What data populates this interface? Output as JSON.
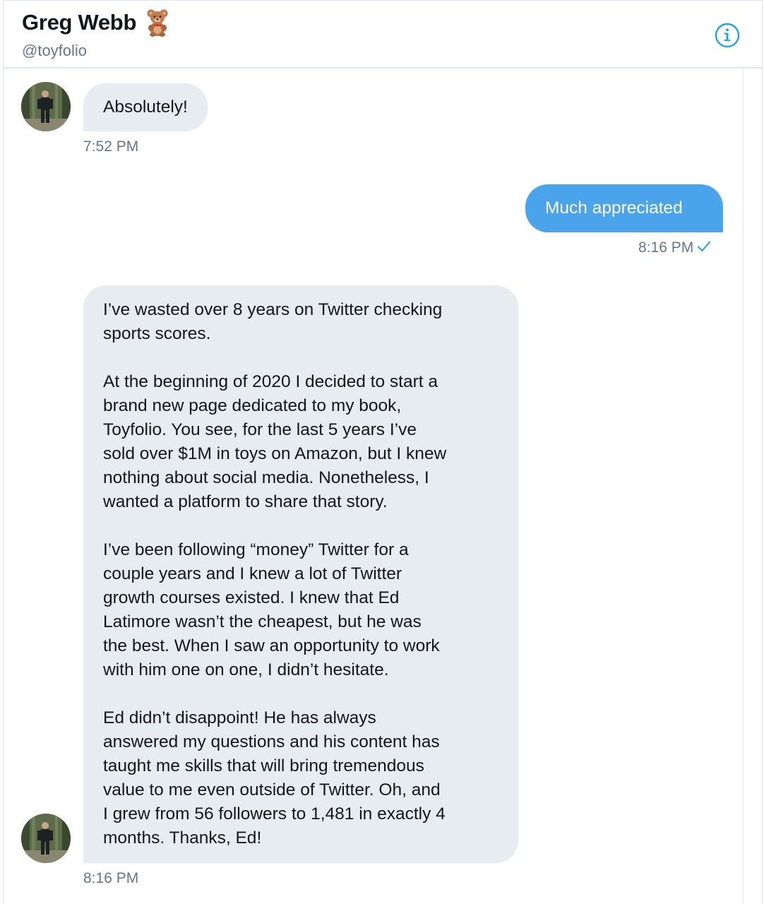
{
  "header": {
    "display_name": "Greg Webb",
    "handle": "@toyfolio",
    "name_emoji_icon": "teddy-bear-icon",
    "info_icon": "info-icon"
  },
  "colors": {
    "incoming_bubble": "#e6ecf0",
    "outgoing_bubble": "#4ba3ec",
    "accent": "#1da1f2",
    "secondary_text": "#657786"
  },
  "messages": [
    {
      "direction": "incoming",
      "text": "Absolutely!",
      "time": "7:52 PM"
    },
    {
      "direction": "outgoing",
      "text": "Much appreciated",
      "time": "8:16 PM",
      "status_icon": "sent-check-icon"
    },
    {
      "direction": "incoming",
      "paragraphs": [
        "I’ve wasted over 8 years on Twitter checking\nsports scores.",
        "At the beginning of 2020 I decided to start a\nbrand new page dedicated to my book,\nToyfolio. You see, for the last 5 years I’ve\nsold over $1M in toys on Amazon, but I knew\nnothing about social media. Nonetheless, I\nwanted a platform to share that story.",
        "I’ve been following “money” Twitter for a\ncouple years and I knew a lot of Twitter\ngrowth courses existed. I knew that Ed\nLatimore wasn’t the cheapest, but he was\nthe best. When I saw an opportunity to work\nwith him one on one, I didn’t hesitate.",
        "Ed didn’t disappoint! He has always\nanswered my questions and his content has\ntaught me skills that will  bring tremendous\nvalue to me even outside of Twitter. Oh, and\nI grew from 56 followers to 1,481 in exactly 4\nmonths. Thanks, Ed!"
      ],
      "time": "8:16 PM"
    }
  ]
}
